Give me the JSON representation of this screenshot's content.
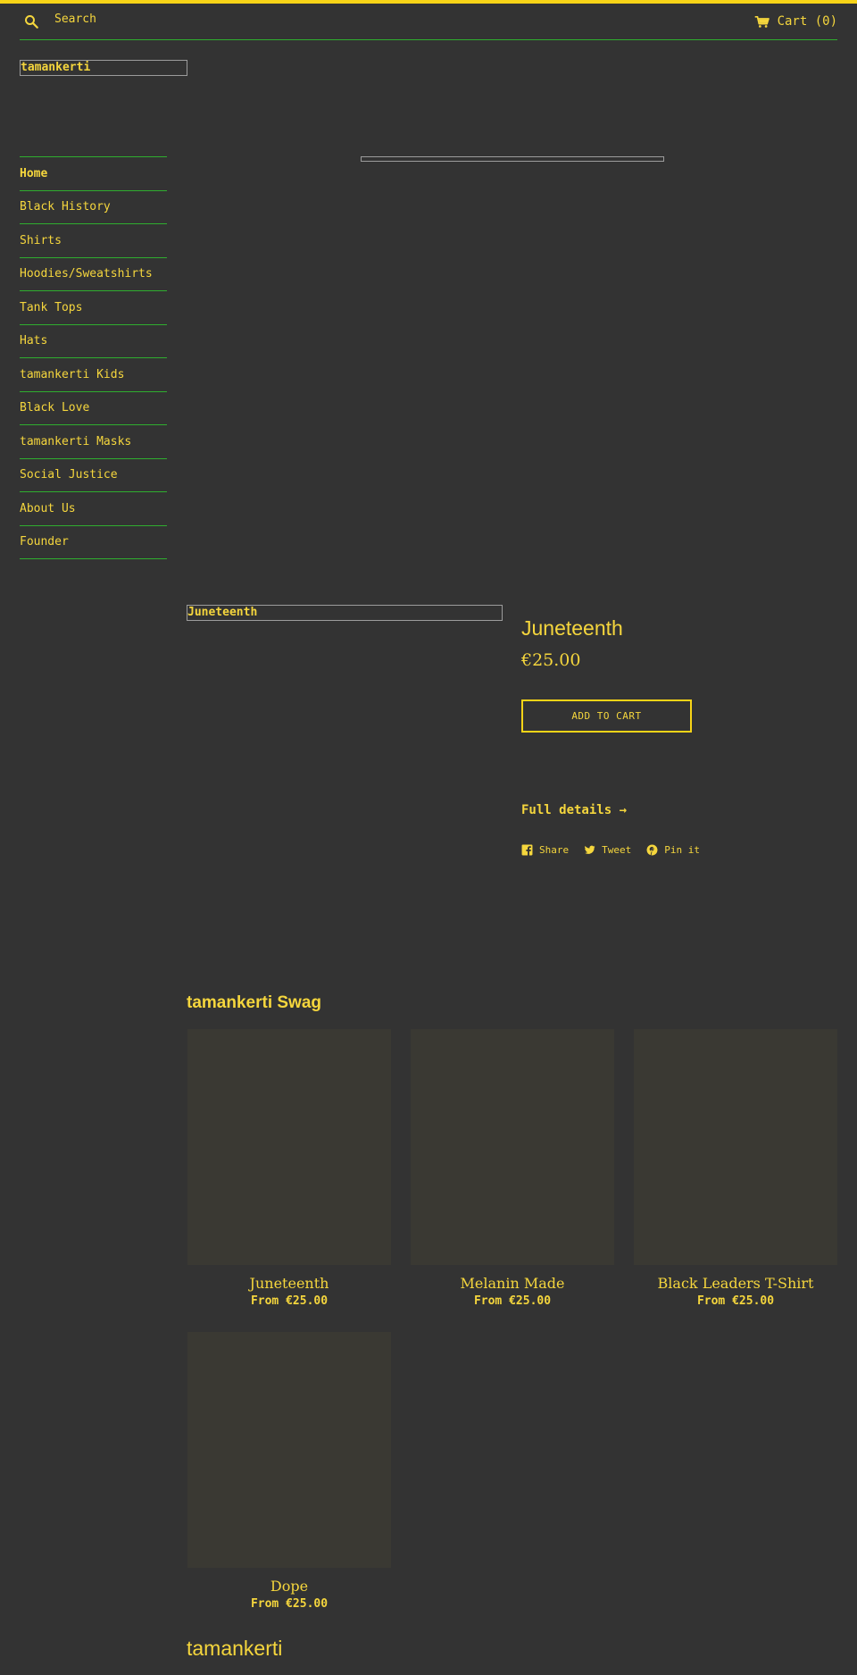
{
  "colors": {
    "background": "#333333",
    "accent": "#f8d417",
    "text": "#f5d63d",
    "divider": "#2fae2f",
    "card": "#3a3933"
  },
  "header": {
    "search_label": "Search",
    "cart_label": "Cart (0)"
  },
  "logo": {
    "alt": "tamankerti"
  },
  "nav": {
    "items": [
      {
        "label": "Home"
      },
      {
        "label": "Black History"
      },
      {
        "label": "Shirts"
      },
      {
        "label": "Hoodies/Sweatshirts"
      },
      {
        "label": "Tank Tops"
      },
      {
        "label": "Hats"
      },
      {
        "label": "tamankerti Kids"
      },
      {
        "label": "Black Love"
      },
      {
        "label": "tamankerti Masks"
      },
      {
        "label": "Social Justice"
      },
      {
        "label": "About Us"
      },
      {
        "label": "Founder"
      }
    ]
  },
  "product": {
    "image_alt": "Juneteenth",
    "title": "Juneteenth",
    "price": "€25.00",
    "add_to_cart": "ADD TO CART",
    "full_details": "Full details →",
    "share": "Share",
    "tweet": "Tweet",
    "pin": "Pin it"
  },
  "collection": {
    "title": "tamankerti Swag",
    "products": [
      {
        "name": "Juneteenth",
        "price": "From €25.00"
      },
      {
        "name": "Melanin Made",
        "price": "From €25.00"
      },
      {
        "name": "Black Leaders T-Shirt",
        "price": "From €25.00"
      },
      {
        "name": "Dope",
        "price": "From €25.00"
      }
    ]
  },
  "footer": {
    "title": "tamankerti"
  }
}
